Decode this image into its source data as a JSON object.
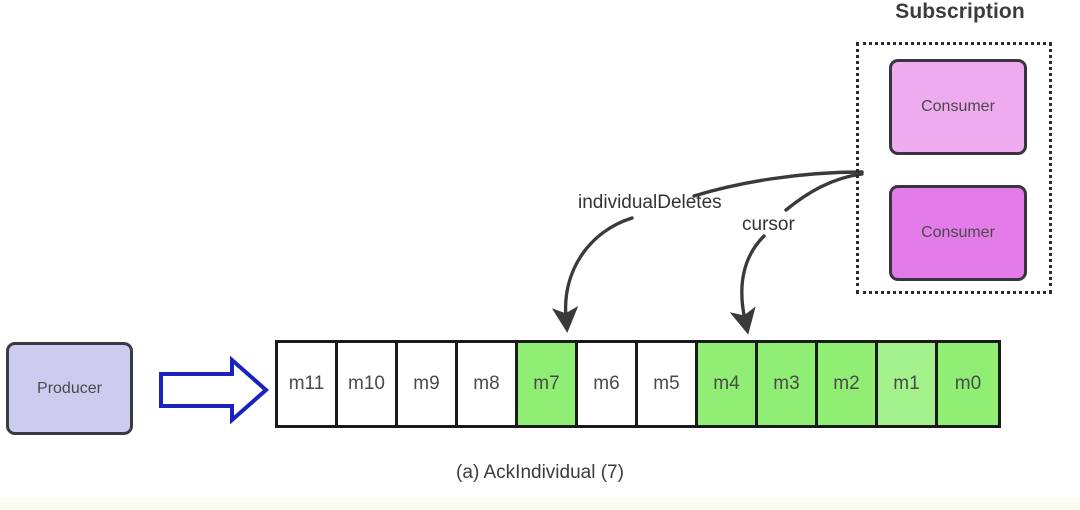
{
  "subscription": {
    "title": "Subscription",
    "consumers": [
      {
        "label": "Consumer",
        "color": "#eeacee"
      },
      {
        "label": "Consumer",
        "color": "#e37ce8"
      }
    ]
  },
  "producer": {
    "label": "Producer",
    "color": "#ccccf0",
    "arrow_color": "#1a22c0"
  },
  "queue": {
    "cells": [
      {
        "label": "m11",
        "state": "unacked",
        "color": "#ffffff"
      },
      {
        "label": "m10",
        "state": "unacked",
        "color": "#ffffff"
      },
      {
        "label": "m9",
        "state": "unacked",
        "color": "#ffffff"
      },
      {
        "label": "m8",
        "state": "unacked",
        "color": "#ffffff"
      },
      {
        "label": "m7",
        "state": "acked",
        "color": "#90ee74"
      },
      {
        "label": "m6",
        "state": "unacked",
        "color": "#ffffff"
      },
      {
        "label": "m5",
        "state": "unacked",
        "color": "#ffffff"
      },
      {
        "label": "m4",
        "state": "acked",
        "color": "#90ee74"
      },
      {
        "label": "m3",
        "state": "acked",
        "color": "#90ee74"
      },
      {
        "label": "m2",
        "state": "acked",
        "color": "#90ee74"
      },
      {
        "label": "m1",
        "state": "acked",
        "color": "#a4f28c"
      },
      {
        "label": "m0",
        "state": "acked",
        "color": "#90ee74"
      }
    ]
  },
  "annotations": {
    "individual_deletes": "individualDeletes",
    "cursor": "cursor"
  },
  "caption": "(a) AckIndividual (7)"
}
